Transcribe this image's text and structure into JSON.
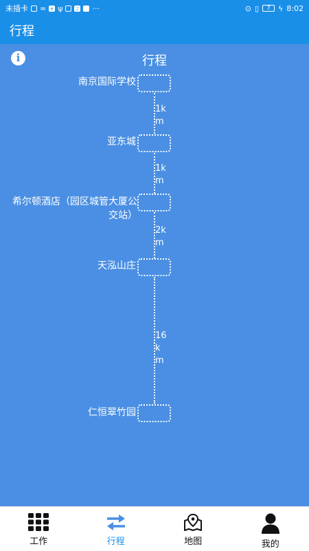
{
  "status_bar": {
    "carrier": "未插卡",
    "battery": "7",
    "time": "8:02",
    "more": "···"
  },
  "app_bar": {
    "title": "行程"
  },
  "page": {
    "title": "行程"
  },
  "route": {
    "stations": [
      {
        "name": "南京国际学校"
      },
      {
        "name": "亚东城"
      },
      {
        "name": "希尔顿酒店（园区城管大厦公交站）"
      },
      {
        "name": "天泓山庄"
      },
      {
        "name": "仁恒翠竹园"
      }
    ],
    "distances": [
      "1km",
      "1km",
      "2km",
      "16km"
    ]
  },
  "tabs": [
    {
      "label": "工作",
      "icon": "grid-icon"
    },
    {
      "label": "行程",
      "icon": "swap-arrows-icon"
    },
    {
      "label": "地图",
      "icon": "map-pin-icon"
    },
    {
      "label": "我的",
      "icon": "person-icon"
    }
  ],
  "colors": {
    "accent": "#1a8fe8",
    "background": "#4a8fe3"
  }
}
